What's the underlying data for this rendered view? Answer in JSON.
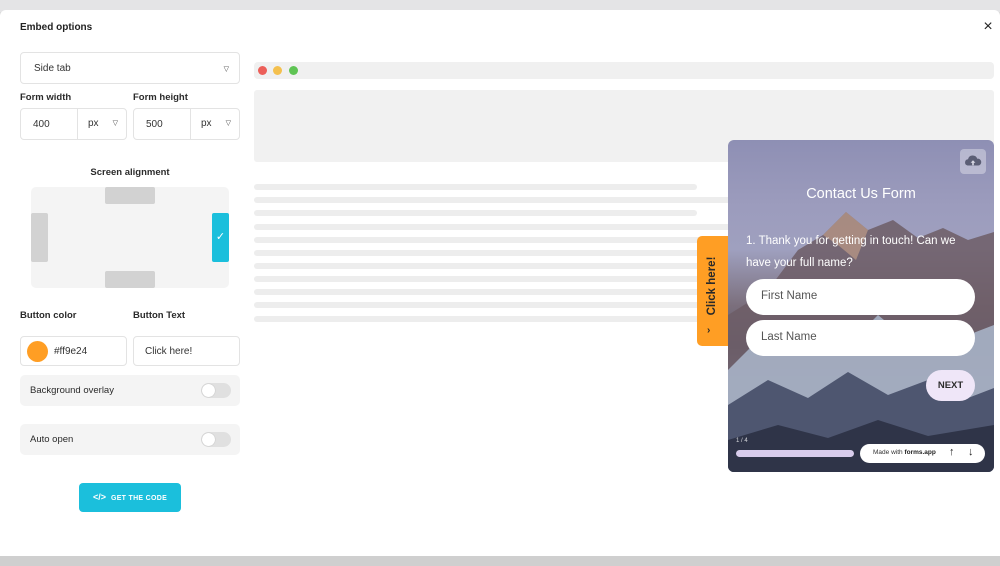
{
  "modal": {
    "title": "Embed options",
    "close_icon": "×"
  },
  "settings": {
    "embed_type": "Side tab",
    "form_width_label": "Form width",
    "form_width_value": "400",
    "form_width_unit": "px",
    "form_height_label": "Form height",
    "form_height_value": "500",
    "form_height_unit": "px",
    "alignment_title": "Screen alignment",
    "alignment_selected": "right",
    "check_icon": "✓",
    "button_color_label": "Button color",
    "button_color_value": "#ff9e24",
    "button_text_label": "Button Text",
    "button_text_value": "Click here!",
    "background_overlay_label": "Background overlay",
    "background_overlay_on": false,
    "auto_open_label": "Auto open",
    "auto_open_on": false,
    "get_code_icon": "</>",
    "get_code_label": "GET THE CODE"
  },
  "preview": {
    "side_tab_text": "Click here!",
    "side_tab_chevron": "›",
    "form_title": "Contact Us Form",
    "question": "1. Thank you for getting in touch! Can we have your full name?",
    "first_name_placeholder": "First Name",
    "last_name_placeholder": "Last Name",
    "next_label": "NEXT",
    "progress_label": "1 / 4",
    "progress_fraction": 1.0,
    "made_with_prefix": "Made with",
    "made_with_brand": "forms.app",
    "arrow_up": "↑",
    "arrow_down": "↓"
  },
  "colors": {
    "accent": "#1bbfdc",
    "tab_button": "#ff9e24",
    "window_dots": [
      "#ec5f59",
      "#f4c04e",
      "#5fc454"
    ]
  },
  "icons": {
    "close": "close-icon",
    "caret": "caret-down-icon",
    "check": "check-icon",
    "code": "code-icon",
    "cloud": "cloud-upload-icon",
    "chevron": "chevron-right-icon"
  }
}
